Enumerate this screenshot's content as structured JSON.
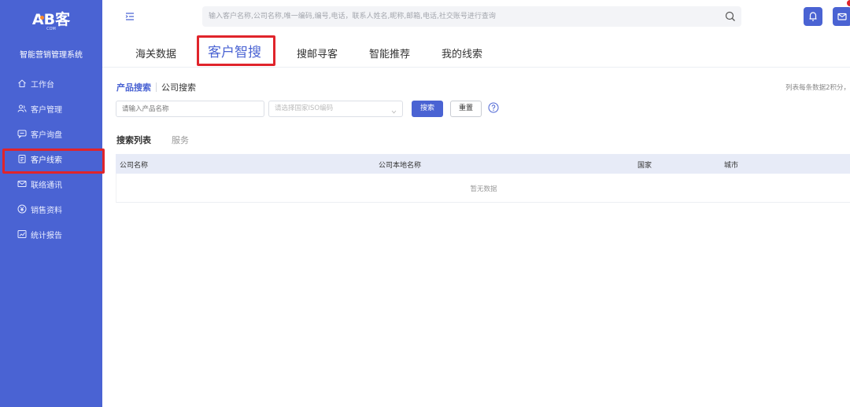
{
  "brand": {
    "logo_text": "AB客",
    "logo_sub": "COM",
    "system_name": "智能营销管理系统"
  },
  "sidebar": {
    "items": [
      {
        "label": "工作台",
        "icon": "home-icon"
      },
      {
        "label": "客户管理",
        "icon": "users-icon"
      },
      {
        "label": "客户询盘",
        "icon": "chat-icon"
      },
      {
        "label": "客户线索",
        "icon": "clipboard-icon",
        "active": true
      },
      {
        "label": "联络通讯",
        "icon": "mail-icon"
      },
      {
        "label": "销售资料",
        "icon": "yen-icon"
      },
      {
        "label": "统计报告",
        "icon": "chart-icon"
      }
    ]
  },
  "topbar": {
    "search_placeholder": "输入客户名称,公司名称,唯一编码,编号,电话，联系人姓名,昵称,邮箱,电话,社交账号进行查询"
  },
  "tabs": [
    {
      "label": "海关数据"
    },
    {
      "label": "客户智搜",
      "active": true
    },
    {
      "label": "搜邮寻客"
    },
    {
      "label": "智能推荐"
    },
    {
      "label": "我的线索"
    }
  ],
  "filters": {
    "subtab_active": "产品搜索",
    "subtab_other": "公司搜索",
    "hint": "列表每条数据2积分，",
    "product_placeholder": "请输入产品名称",
    "country_placeholder": "请选择国家ISO编码",
    "search_button": "搜索",
    "reset_button": "重置"
  },
  "list": {
    "tab_active": "搜索列表",
    "tab_other": "服务",
    "columns": [
      "公司名称",
      "公司本地名称",
      "国家",
      "城市"
    ],
    "rows": [],
    "empty_text": "暂无数据"
  },
  "colors": {
    "primary": "#4a63d3",
    "highlight": "#e0242b"
  }
}
